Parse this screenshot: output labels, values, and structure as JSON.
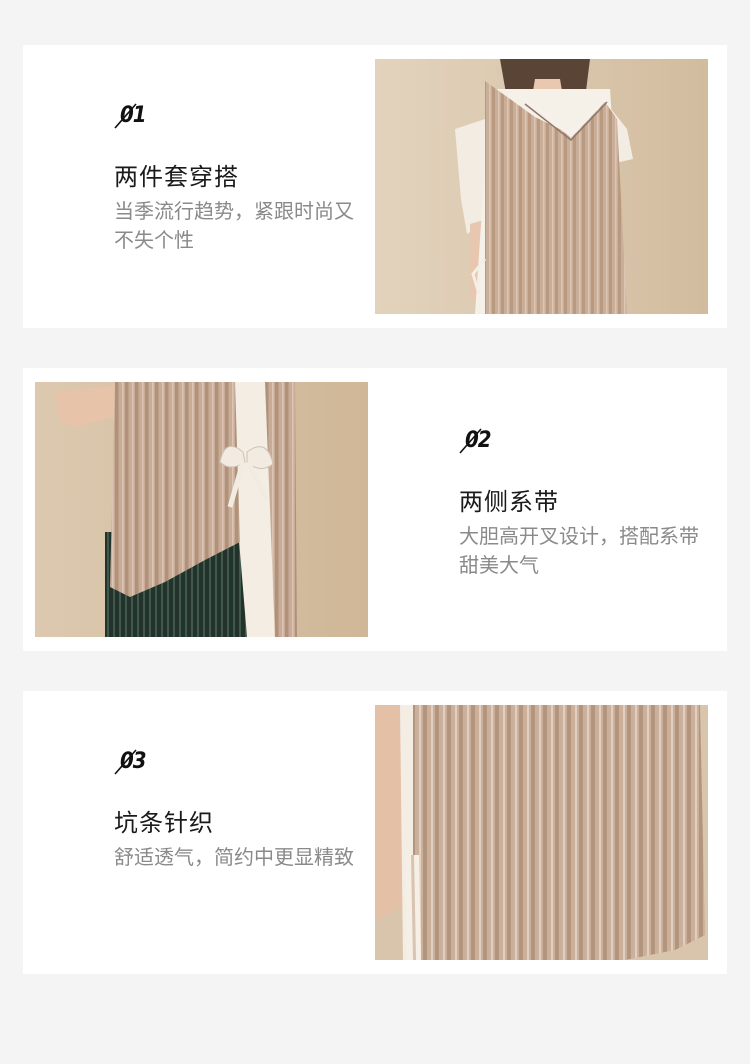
{
  "colors": {
    "page_background": "#f4f4f4",
    "card_background": "#ffffff",
    "title": "#1a1a1a",
    "description": "#8a8a8a",
    "knit": "#c7ab97",
    "wall": "#d7c2a6"
  },
  "features": [
    {
      "number": "01",
      "title": "两件套穿搭",
      "description": "当季流行趋势，紧跟时尚又不失个性",
      "image_icon": "vest-over-tshirt-photo"
    },
    {
      "number": "02",
      "title": "两侧系带",
      "description": "大胆高开叉设计，搭配系带甜美大气",
      "image_icon": "side-tie-bow-photo"
    },
    {
      "number": "03",
      "title": "坑条针织",
      "description": "舒适透气，简约中更显精致",
      "image_icon": "ribbed-knit-closeup-photo"
    }
  ]
}
